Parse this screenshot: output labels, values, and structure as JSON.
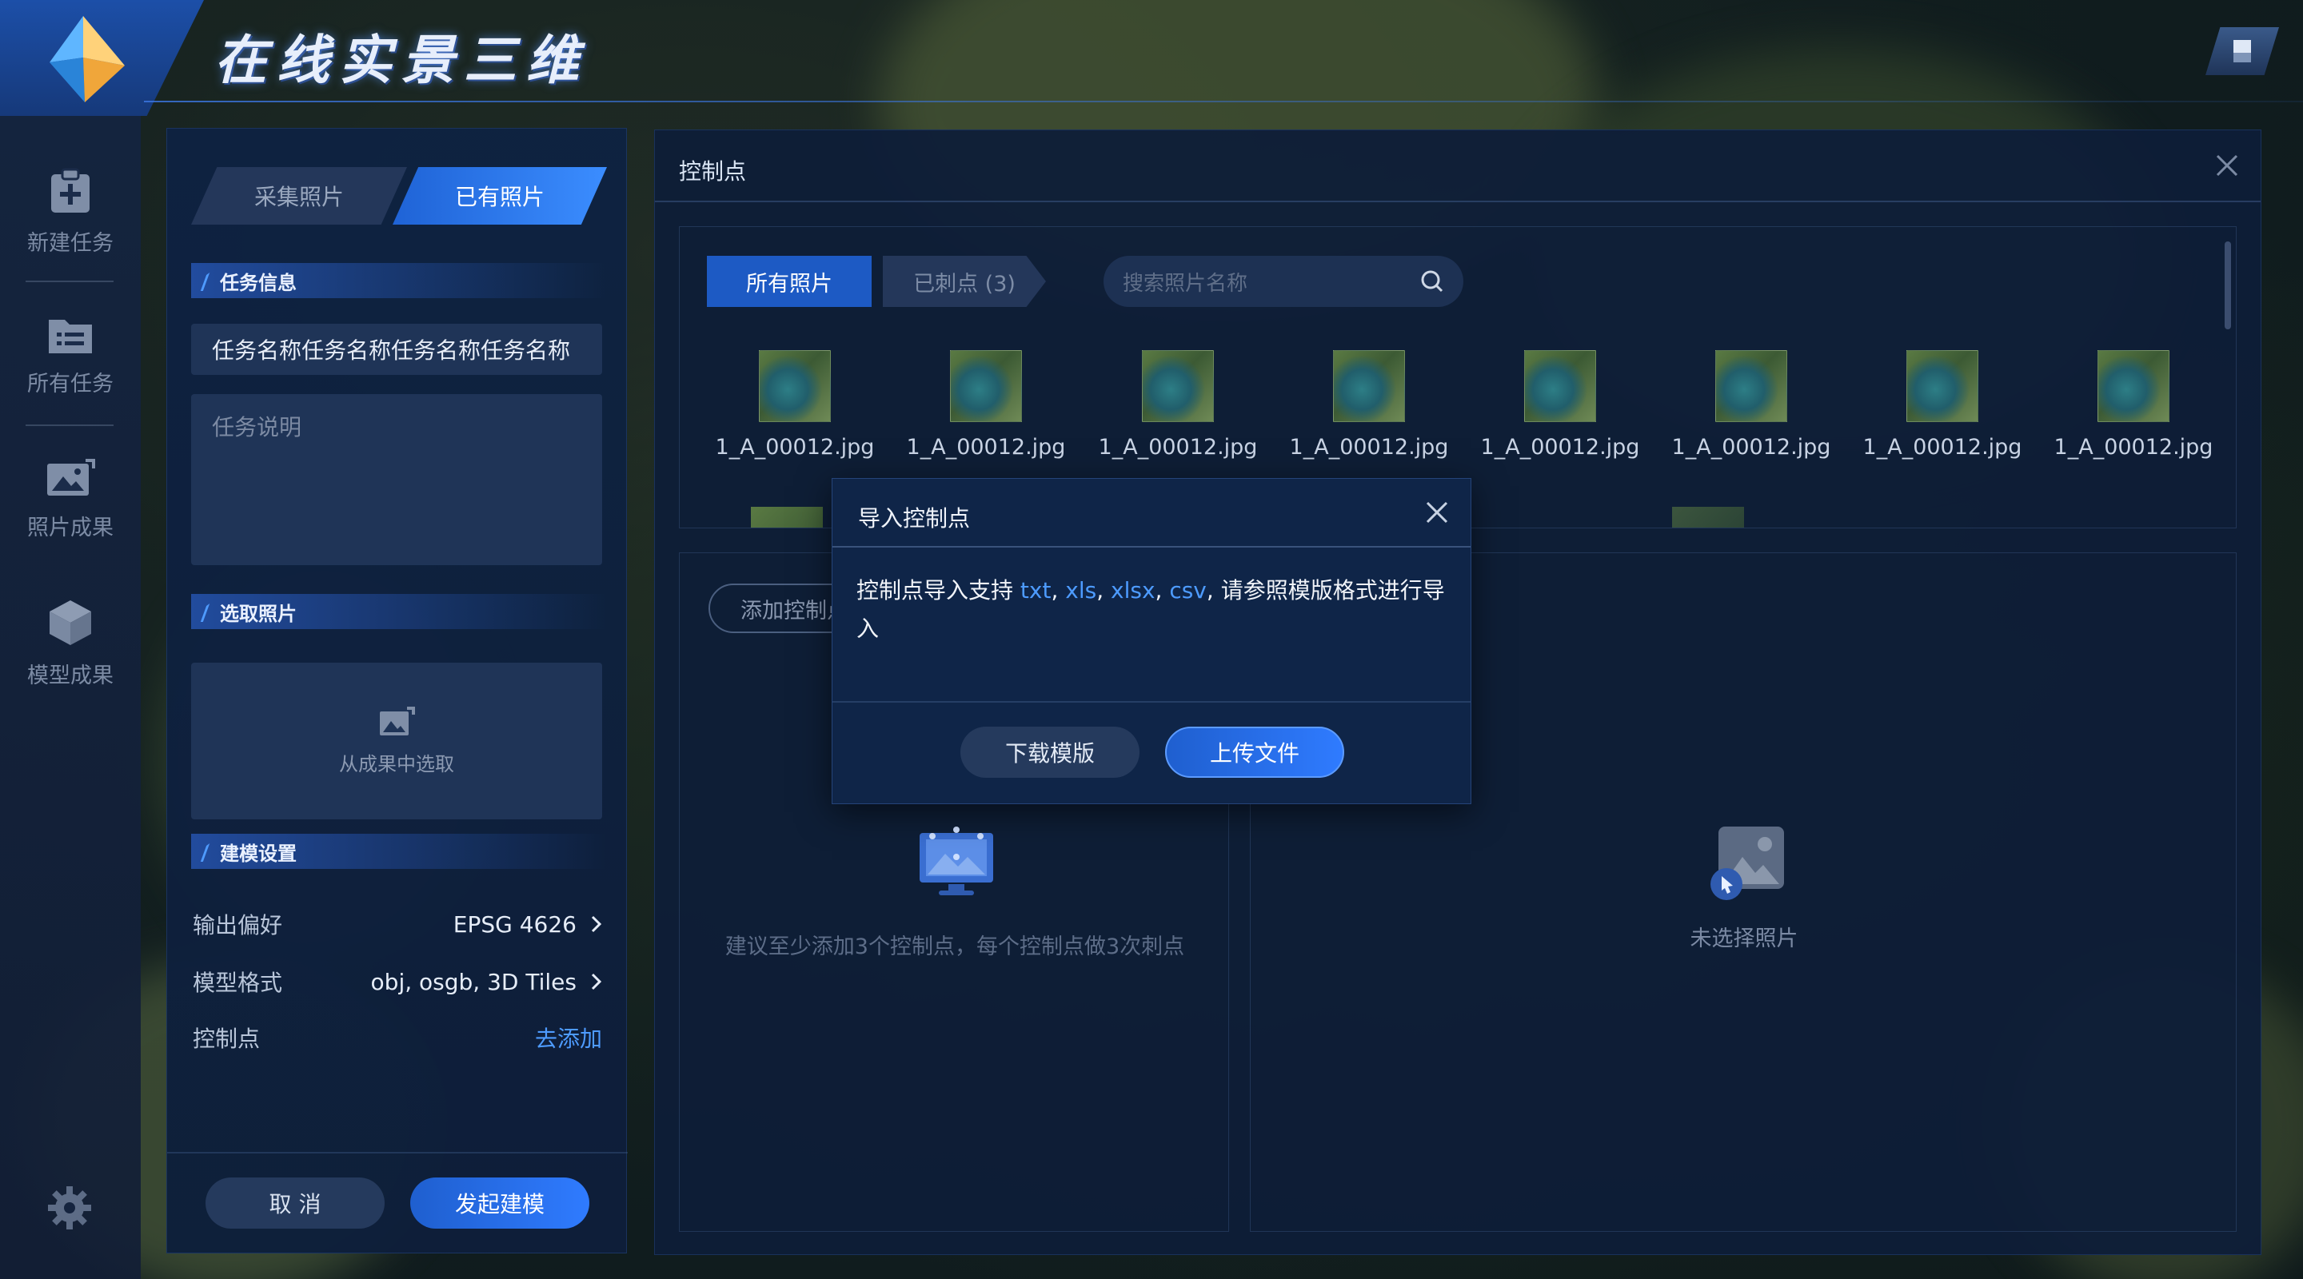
{
  "app": {
    "title": "在线实景三维"
  },
  "nav": {
    "items": [
      {
        "label": "新建任务",
        "icon": "clipboard-add-icon"
      },
      {
        "label": "所有任务",
        "icon": "folder-list-icon"
      },
      {
        "label": "照片成果",
        "icon": "photo-icon"
      },
      {
        "label": "模型成果",
        "icon": "cube-icon"
      }
    ],
    "settings_icon": "gear-icon"
  },
  "task_panel": {
    "tabs": [
      "采集照片",
      "已有照片"
    ],
    "active_tab": "已有照片",
    "sections": {
      "task_info": "任务信息",
      "select_photos": "选取照片",
      "modeling": "建模设置"
    },
    "task_name": "任务名称任务名称任务名称任务名称",
    "task_desc_placeholder": "任务说明",
    "pick_from_results": "从成果中选取",
    "settings": {
      "output_label": "输出偏好",
      "output_value": "EPSG 4626",
      "format_label": "模型格式",
      "format_value": "obj, osgb, 3D Tiles",
      "cp_label": "控制点",
      "cp_link": "去添加"
    },
    "cancel": "取 消",
    "submit": "发起建模"
  },
  "cp_panel": {
    "title": "控制点",
    "tab_all": "所有照片",
    "tab_marked": "已刺点 (3)",
    "search_placeholder": "搜索照片名称",
    "photos": [
      "1_A_00012.jpg",
      "1_A_00012.jpg",
      "1_A_00012.jpg",
      "1_A_00012.jpg",
      "1_A_00012.jpg",
      "1_A_00012.jpg",
      "1_A_00012.jpg",
      "1_A_00012.jpg"
    ],
    "add_cp": "添加控制点",
    "hint": "建议至少添加3个控制点，每个控制点做3次刺点",
    "no_photo": "未选择照片"
  },
  "modal": {
    "title": "导入控制点",
    "body_prefix": "控制点导入支持 ",
    "ext_txt": "txt",
    "ext_xls": "xls",
    "ext_xlsx": "xlsx",
    "ext_csv": "csv",
    "sep": ", ",
    "body_suffix": ", 请参照模版格式进行导入",
    "download": "下载模版",
    "upload": "上传文件"
  },
  "colors": {
    "accent": "#2f7bff",
    "panel": "#0e2242",
    "link": "#4e9bff"
  }
}
